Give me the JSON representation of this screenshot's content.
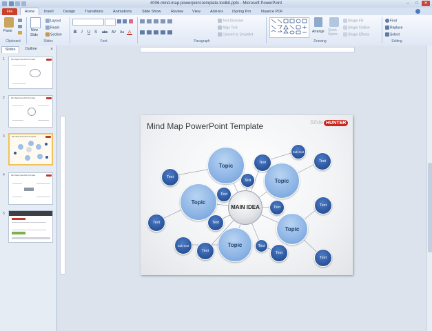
{
  "window": {
    "title": "4006-mind-map-powerpoint-template-toolkit.pptx - Microsoft PowerPoint",
    "controls": [
      "–",
      "□",
      "✕"
    ]
  },
  "tabs": [
    "File",
    "Home",
    "Insert",
    "Design",
    "Transitions",
    "Animations",
    "Slide Show",
    "Review",
    "View",
    "Add-Ins",
    "iSpring Pro",
    "Nuance PDF"
  ],
  "ribbon": {
    "clipboard": {
      "paste": "Paste",
      "label": "Clipboard"
    },
    "slides": {
      "new_slide": "New",
      "new_slide2": "Slide",
      "layout": "Layout",
      "reset": "Reset",
      "section": "Section",
      "label": "Slides"
    },
    "font": {
      "label": "Font",
      "format_buttons": [
        "B",
        "I",
        "U",
        "S",
        "abc",
        "AV",
        "Aa",
        "A"
      ]
    },
    "paragraph": {
      "label": "Paragraph",
      "text_direction": "Text Direction",
      "align_text": "Align Text",
      "convert_smartart": "Convert to SmartArt"
    },
    "drawing": {
      "label": "Drawing",
      "arrange": "Arrange",
      "quick_styles": "Quick Styles",
      "shape_fill": "Shape Fill",
      "shape_outline": "Shape Outline",
      "shape_effects": "Shape Effects"
    },
    "editing": {
      "label": "Editing",
      "find": "Find",
      "replace": "Replace",
      "select": "Select"
    }
  },
  "left_pane": {
    "tabs": [
      "Slides",
      "Outline"
    ],
    "close": "×",
    "slides": [
      {
        "num": "1",
        "title": "Mind Map PowerPoint Template"
      },
      {
        "num": "2",
        "title": "Mind Map PowerPoint Template"
      },
      {
        "num": "3",
        "title": "Mind Map PowerPoint Template"
      },
      {
        "num": "4",
        "title": "Mind Map PowerPoint Template"
      },
      {
        "num": "5",
        "title": ""
      }
    ]
  },
  "slide": {
    "title": "Mind Map PowerPoint Template",
    "logo_a": "Slide",
    "logo_b": "HUNTER",
    "main_idea": "MAIN IDEA",
    "topic": "Topic",
    "text": "Text",
    "subtext": "Sub-text"
  }
}
